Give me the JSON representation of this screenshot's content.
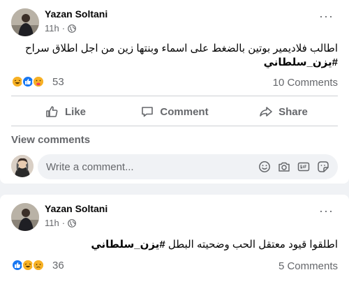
{
  "post1": {
    "author": "Yazan Soltani",
    "time": "11h",
    "dot": "·",
    "text": "اطالب فلاديمير بوتين بالضغط على اسماء وبنتها زين من اجل اطلاق سراح",
    "hashtag": "#يزن_سلطاني",
    "reactions_count": "53",
    "comments_count": "10 Comments",
    "actions": {
      "like": "Like",
      "comment": "Comment",
      "share": "Share"
    },
    "view_comments": "View comments",
    "comment_placeholder": "Write a comment...",
    "more": "···"
  },
  "post2": {
    "author": "Yazan Soltani",
    "time": "11h",
    "dot": "·",
    "text": "اطلقوا قيود معتقل الحب وضحيته البطل",
    "hashtag": "#يزن_سلطاني",
    "reactions_count": "36",
    "comments_count": "5 Comments",
    "more": "···"
  },
  "colors": {
    "like_blue": "#1877f2",
    "haha_yellow": "#f7b125",
    "love_red": "#f33e58",
    "text_secondary": "#65676b"
  },
  "icons": [
    "globe-icon",
    "like-icon",
    "comment-icon",
    "share-icon",
    "emoji-icon",
    "camera-icon",
    "gif-icon",
    "sticker-icon"
  ]
}
